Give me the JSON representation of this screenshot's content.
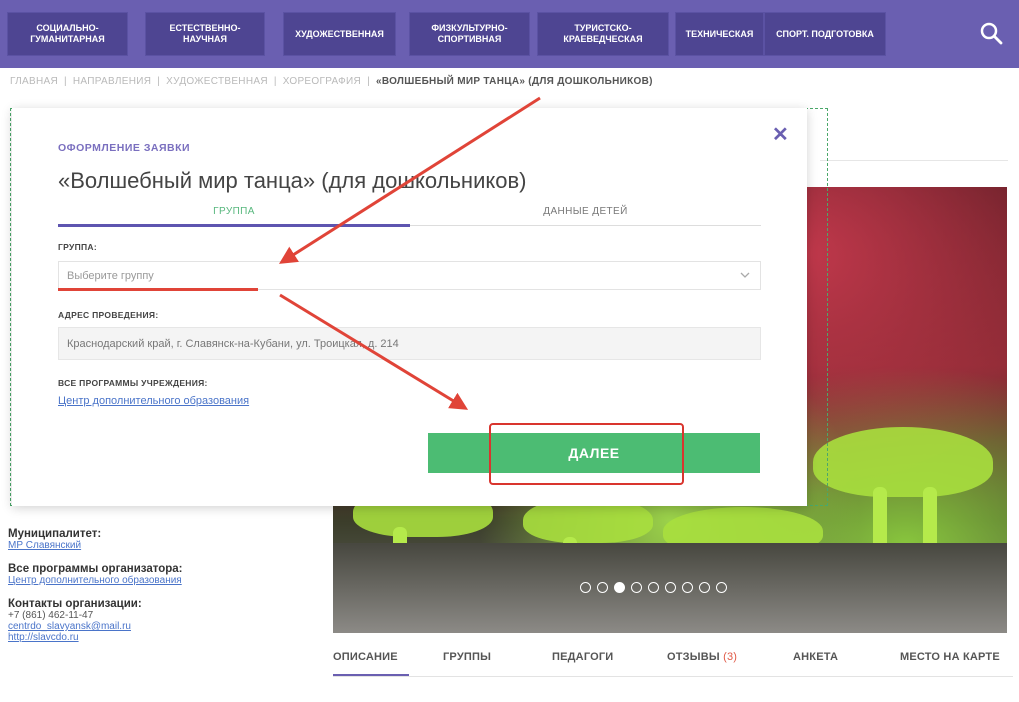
{
  "nav": {
    "items": [
      "СОЦИАЛЬНО-\nГУМАНИТАРНАЯ",
      "ЕСТЕСТВЕННО-\nНАУЧНАЯ",
      "ХУДОЖЕСТВЕННАЯ",
      "ФИЗКУЛЬТУРНО-\nСПОРТИВНАЯ",
      "ТУРИСТСКО-\nКРАЕВЕДЧЕСКАЯ",
      "ТЕХНИЧЕСКАЯ",
      "СПОРТ. ПОДГОТОВКА"
    ],
    "search_icon": "search-icon"
  },
  "breadcrumb": {
    "items": [
      "ГЛАВНАЯ",
      "НАПРАВЛЕНИЯ",
      "ХУДОЖЕСТВЕННАЯ",
      "ХОРЕОГРАФИЯ"
    ],
    "current": "«ВОЛШЕБНЫЙ МИР ТАНЦА» (ДЛЯ ДОШКОЛЬНИКОВ)",
    "separator": "|"
  },
  "background": {
    "title_tail": ")"
  },
  "modal": {
    "kicker": "ОФОРМЛЕНИЕ ЗАЯВКИ",
    "title": "«Волшебный мир танца» (для дошкольников)",
    "close_glyph": "✕",
    "steps": [
      "ГРУППА",
      "ДАННЫЕ ДЕТЕЙ"
    ],
    "group_label": "ГРУППА:",
    "group_placeholder": "Выберите группу",
    "address_label": "АДРЕС ПРОВЕДЕНИЯ:",
    "address_value": "Краснодарский край, г. Славянск-на-Кубани, ул. Троицкая, д. 214",
    "programs_label": "ВСЕ ПРОГРАММЫ УЧРЕЖДЕНИЯ:",
    "programs_link": "Центр дополнительного образования",
    "next_button": "ДАЛЕЕ"
  },
  "sidebar": {
    "municipality_label": "Муниципалитет:",
    "municipality_value": "МР Славянский",
    "org_programs_label": "Все программы организатора:",
    "org_programs_value": "Центр дополнительного образования",
    "contacts_label": "Контакты организации:",
    "phone": "+7 (861) 462-11-47",
    "email": "centrdo_slavyansk@mail.ru",
    "site": "http://slavcdo.ru"
  },
  "slider": {
    "dot_count": 9,
    "active_index": 2
  },
  "tabs": {
    "items": [
      "ОПИСАНИЕ",
      "ГРУППЫ",
      "ПЕДАГОГИ",
      "ОТЗЫВЫ",
      "АНКЕТА",
      "МЕСТО НА КАРТЕ"
    ],
    "reviews_count": "(3)"
  },
  "colors": {
    "nav_bg": "#6a5fb1",
    "nav_btn": "#4e4592",
    "accent": "#5e55b0",
    "next_button": "#4cbc73",
    "annotation_red": "#e04438"
  }
}
